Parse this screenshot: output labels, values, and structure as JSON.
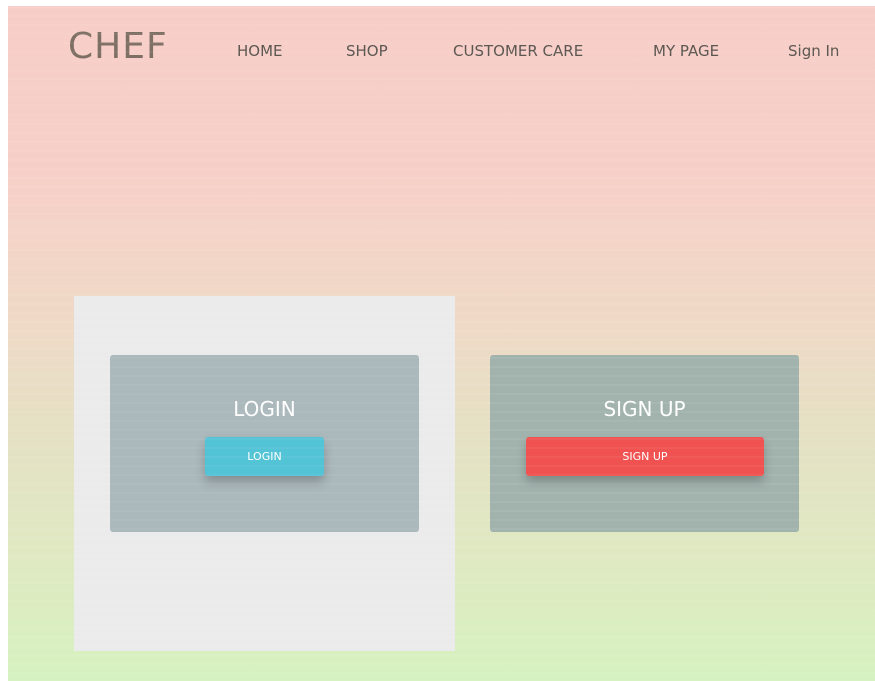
{
  "header": {
    "brand": "CHEF",
    "nav": {
      "home": "HOME",
      "shop": "SHOP",
      "customer_care": "CUSTOMER CARE",
      "my_page": "MY PAGE",
      "sign_in": "Sign In"
    }
  },
  "login_card": {
    "title": "LOGIN",
    "button_label": "LOGIN"
  },
  "signup_card": {
    "title": "SIGN UP",
    "button_label": "SIGN UP"
  },
  "colors": {
    "login_button": "#53c3d6",
    "signup_button": "#ef5250",
    "brand_text": "#7d6f63"
  }
}
